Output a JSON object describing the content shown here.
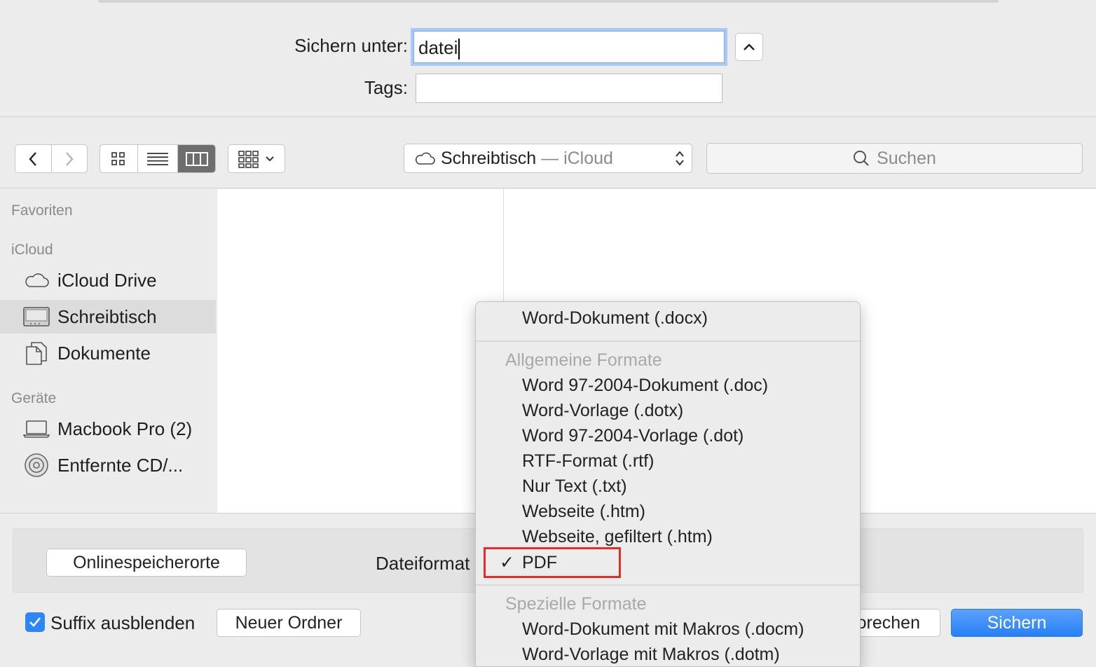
{
  "save": {
    "label": "Sichern unter:",
    "filename": "datei",
    "tags_label": "Tags:",
    "tags_value": ""
  },
  "toolbar": {
    "location_main": "Schreibtisch",
    "location_sep": " — ",
    "location_sub": "iCloud",
    "search_placeholder": "Suchen"
  },
  "sidebar": {
    "sections": [
      {
        "header": "Favoriten"
      },
      {
        "header": "iCloud"
      },
      {
        "header": "Geräte"
      }
    ],
    "items": [
      {
        "label": "iCloud Drive",
        "icon": "cloud-icon"
      },
      {
        "label": "Schreibtisch",
        "icon": "desktop-icon",
        "selected": true
      },
      {
        "label": "Dokumente",
        "icon": "documents-icon"
      },
      {
        "label": "Macbook Pro (2)",
        "icon": "laptop-icon"
      },
      {
        "label": "Entfernte CD/...",
        "icon": "disc-icon"
      }
    ]
  },
  "bottom": {
    "online_button": "Onlinespeicherorte",
    "format_label": "Dateiformat",
    "hide_suffix_label": "Suffix ausblenden",
    "hide_suffix_checked": true,
    "new_folder_button": "Neuer Ordner",
    "cancel_button_partial": "orechen",
    "save_button": "Sichern"
  },
  "format_menu": {
    "top_item": "Word-Dokument (.docx)",
    "group1_header": "Allgemeine Formate",
    "group1_items": [
      "Word 97-2004-Dokument (.doc)",
      "Word-Vorlage (.dotx)",
      "Word 97-2004-Vorlage (.dot)",
      "RTF-Format (.rtf)",
      "Nur Text (.txt)",
      "Webseite (.htm)",
      "Webseite, gefiltert (.htm)"
    ],
    "selected_item": "PDF",
    "checkmark": "✓",
    "group2_header": "Spezielle Formate",
    "group2_items": [
      "Word-Dokument mit Makros (.docm)",
      "Word-Vorlage mit Makros (.dotm)"
    ],
    "highlight_color": "#e0302a"
  }
}
